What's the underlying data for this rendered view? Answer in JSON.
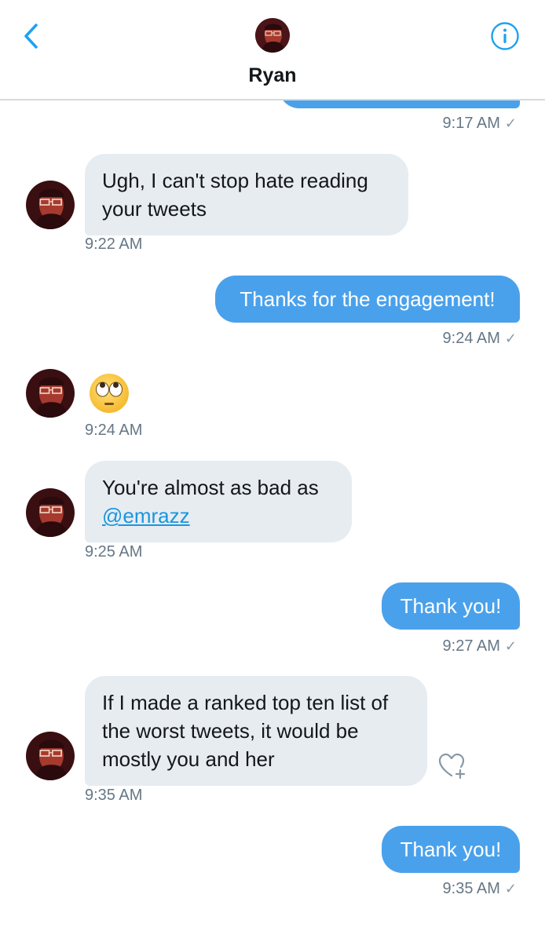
{
  "header": {
    "contact_name": "Ryan",
    "back_icon": "chevron-left-icon",
    "info_icon": "info-icon"
  },
  "colors": {
    "accent": "#1da1f2",
    "outgoing_bubble": "#4aa1eb",
    "incoming_bubble": "#e6ecf0",
    "timestamp": "#657786"
  },
  "messages": [
    {
      "direction": "out",
      "text": "",
      "time": "9:17 AM",
      "read": true,
      "partially_visible": true
    },
    {
      "direction": "in",
      "text": "Ugh, I can't stop hate reading your tweets",
      "time": "9:22 AM"
    },
    {
      "direction": "out",
      "text": "Thanks for the engagement!",
      "time": "9:24 AM",
      "read": true
    },
    {
      "direction": "in",
      "emoji": "face-with-rolling-eyes",
      "time": "9:24 AM"
    },
    {
      "direction": "in",
      "text_before_mention": "You're almost as bad as",
      "mention": "@emrazz",
      "time": "9:25 AM"
    },
    {
      "direction": "out",
      "text": "Thank you!",
      "time": "9:27 AM",
      "read": true
    },
    {
      "direction": "in",
      "text": "If I made a ranked top ten list of the worst tweets, it would be mostly you and her",
      "time": "9:35 AM",
      "reaction_icon": "heart-add-icon"
    },
    {
      "direction": "out",
      "text": "Thank you!",
      "time": "9:35 AM",
      "read": true
    }
  ],
  "read_receipt": "✓"
}
